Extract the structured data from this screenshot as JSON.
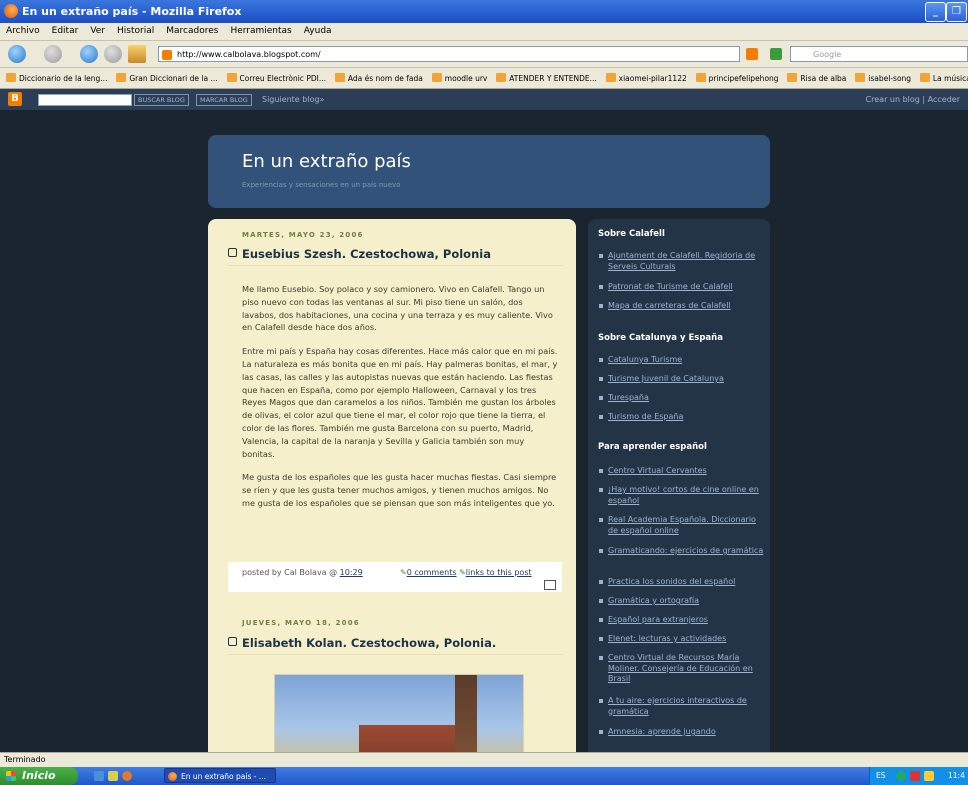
{
  "window": {
    "title": "En un extraño país - Mozilla Firefox",
    "minimize_label": "_",
    "restore_label": "❐"
  },
  "menu": [
    "Archivo",
    "Editar",
    "Ver",
    "Historial",
    "Marcadores",
    "Herramientas",
    "Ayuda"
  ],
  "nav": {
    "url": "http://www.calbolava.blogspot.com/",
    "search_placeholder": "Google"
  },
  "bookmarks": [
    "Diccionario de la leng...",
    "Gran Diccionari de la ...",
    "Correu Electrònic PDI...",
    "Ada és nom de fada",
    "moodle urv",
    "ATENDER Y ENTENDE...",
    "xiaomei-pilar1122",
    "principefelipehong",
    "Risa de alba",
    "isabel-song",
    "La música de"
  ],
  "blogger_bar": {
    "logo": "B",
    "search_button": "BUSCAR BLOG",
    "flag_button": "MARCAR BLOG",
    "next_blog": "Siguiente blog»",
    "create_blog": "Crear un blog | Acceder"
  },
  "blog": {
    "title": "En un extraño país",
    "description": "Experiencias y sensaciones en un país nuevo"
  },
  "posts": [
    {
      "date": "MARTES, MAYO 23, 2006",
      "title": "Eusebius Szesh. Czestochowa, Polonia",
      "paragraphs": [
        "Me llamo Eusebio. Soy polaco y soy camionero. Vivo en Calafell. Tango un piso nuevo con todas las ventanas al sur. Mi piso tiene un salón, dos lavabos, dos habitaciones, una cocina y una terraza y es muy caliente. Vivo en Calafell desde hace dos años.",
        "Entre mi país y España hay cosas diferentes. Hace más calor que en mi país. La naturaleza es más bonita que en mi país. Hay palmeras bonitas, el mar, y las casas, las calles y las autopistas nuevas que están haciendo. Las fiestas que hacen en España, como por ejemplo Halloween, Carnaval y los tres Reyes Magos que dan caramelos a los niños. También me gustan los árboles de olivas, el color azul que tiene el mar, el color rojo que tiene la tierra, el color de las flores. También me gusta Barcelona con su puerto, Madrid, Valencia, la capital de la naranja y Sevilla y Galicia también son muy bonitas.",
        "Me gusta de los españoles que les gusta hacer muchas fiestas. Casi siempre se ríen y que les gusta tener muchos amigos, y tienen muchos amigos. No me gusta de los españoles que se piensan que son más inteligentes que yo."
      ],
      "posted_by": "posted by Cal Bolava @",
      "time": "10:29",
      "comments": "0 comments",
      "links": "links to this post"
    },
    {
      "date": "JUEVES, MAYO 18, 2006",
      "title": "Elisabeth Kolan. Czestochowa, Polonia."
    }
  ],
  "sidebar": [
    {
      "heading": "Sobre Calafell",
      "links": [
        "Ajuntament de Calafell. Regidoria de Serveis Culturals",
        "Patronat de Turisme de Calafell",
        "Mapa de carreteras de Calafell"
      ]
    },
    {
      "heading": "Sobre Catalunya y España",
      "links": [
        "Catalunya Turisme",
        "Turisme Juvenil de Catalunya",
        "Turespaña",
        "Turismo de España"
      ]
    },
    {
      "heading": "Para aprender español",
      "links": [
        "Centro Virtual Cervantes",
        "¡Hay motivo! cortos de cine online en español",
        "Real Academia Española. Diccionario de español online",
        "Gramaticando: ejercicios de gramática",
        "Practica los sonidos del español",
        "Gramática y ortografía",
        "Español para extranjeros",
        "Elenet: lecturas y actividades",
        "Centro Virtual de Recursos María Moliner. Consejería de Educación en Brasil",
        "A tu aire: ejercicios interactivos de gramática",
        "Amnesia: aprende jugando"
      ]
    }
  ],
  "status": "Terminado",
  "taskbar": {
    "start": "Inicio",
    "window_item": "En un extraño país - ...",
    "lang": "ES",
    "clock": "11:4"
  }
}
